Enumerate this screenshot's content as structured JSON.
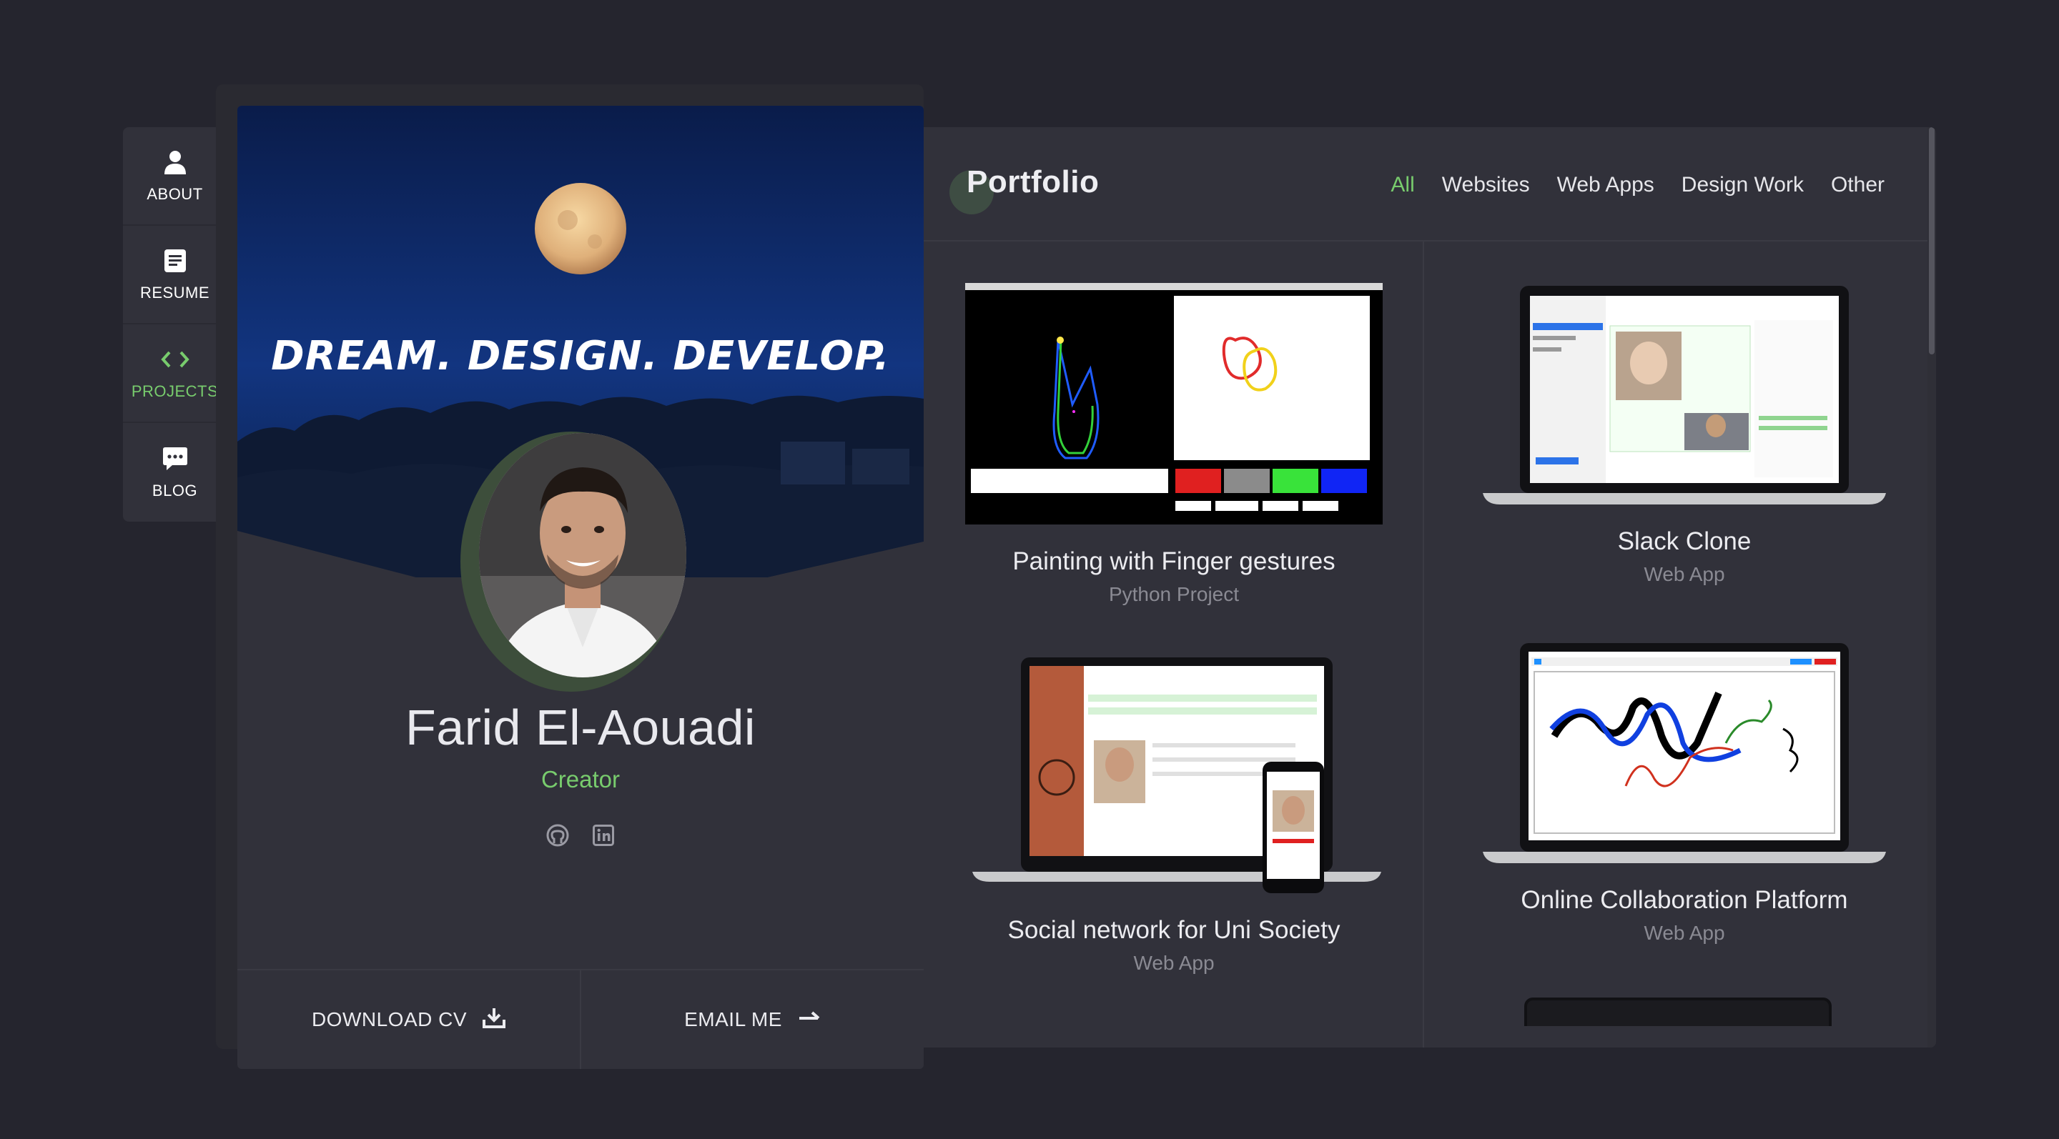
{
  "nav": {
    "items": [
      {
        "label": "ABOUT",
        "icon": "person-icon"
      },
      {
        "label": "RESUME",
        "icon": "document-icon"
      },
      {
        "label": "PROJECTS",
        "icon": "code-icon"
      },
      {
        "label": "BLOG",
        "icon": "chat-icon"
      }
    ],
    "active": "PROJECTS"
  },
  "profile": {
    "tagline": "DREAM. DESIGN. DEVELOP.",
    "name": "Farid El-Aouadi",
    "role": "Creator",
    "socials": [
      "github-icon",
      "linkedin-icon"
    ],
    "download_cv": "DOWNLOAD CV",
    "email_me": "EMAIL ME"
  },
  "portfolio": {
    "title": "Portfolio",
    "filters": [
      "All",
      "Websites",
      "Web Apps",
      "Design Work",
      "Other"
    ],
    "active_filter": "All",
    "projects": [
      {
        "title": "Painting with Finger gestures",
        "category": "Python Project"
      },
      {
        "title": "Slack Clone",
        "category": "Web App"
      },
      {
        "title": "Social network for Uni Society",
        "category": "Web App"
      },
      {
        "title": "Online Collaboration Platform",
        "category": "Web App"
      }
    ]
  },
  "colors": {
    "accent": "#78cc6d",
    "background": "#25252e",
    "panel": "#31313a"
  }
}
